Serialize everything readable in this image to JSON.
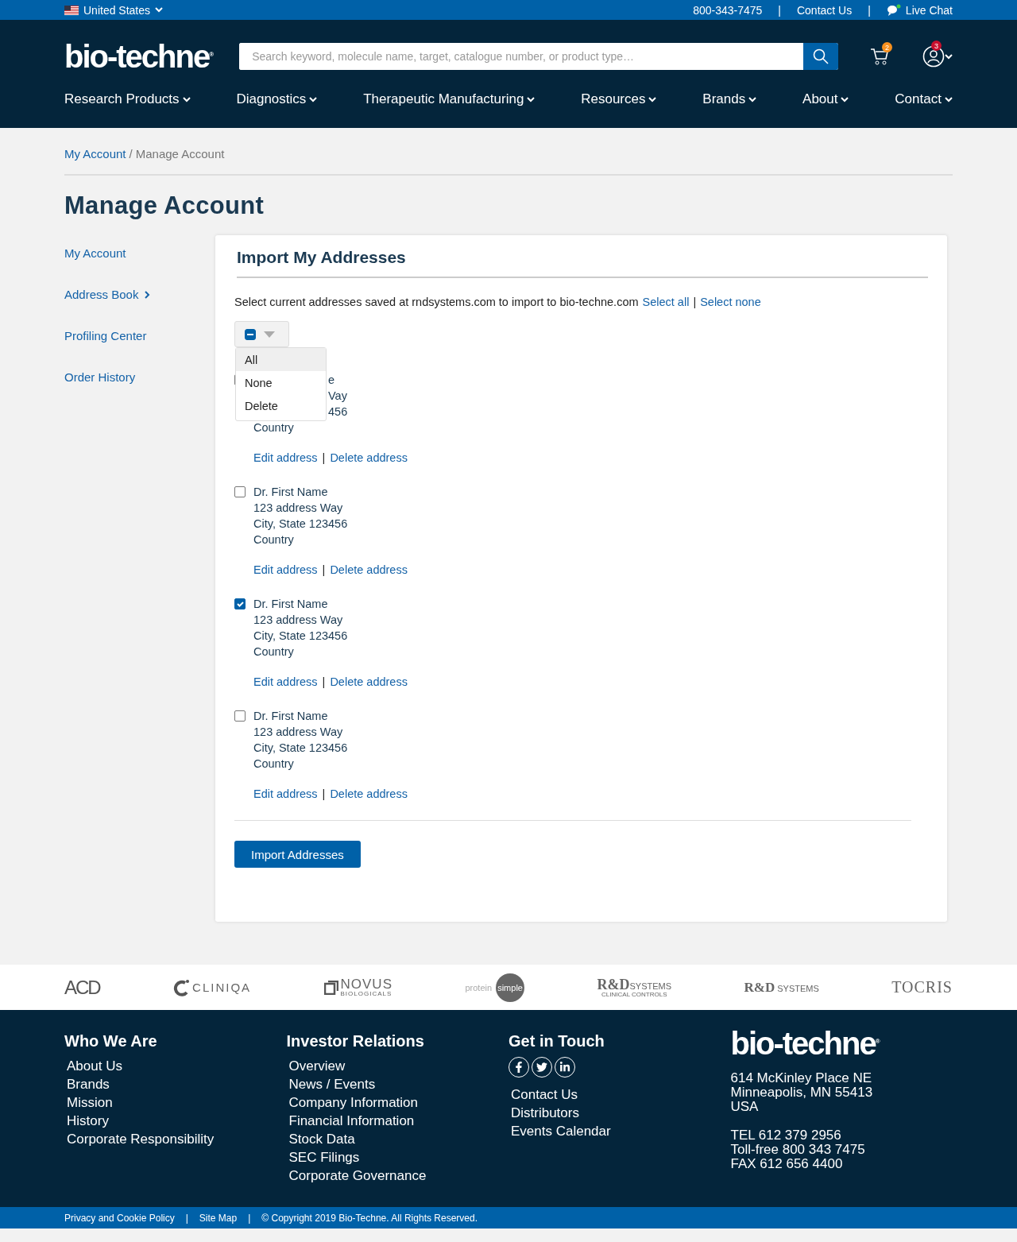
{
  "top_bar": {
    "country": "United States",
    "phone": "800-343-7475",
    "contact": "Contact Us",
    "chat": "Live Chat",
    "separators": [
      "|",
      "|"
    ]
  },
  "header": {
    "logo": "bio-techne",
    "logo_mark": "®",
    "search": {
      "placeholder": "Search keyword, molecule name, target, catalogue number, or product type…"
    },
    "cart_count": "2",
    "account_count": "3"
  },
  "nav": [
    "Research Products",
    "Diagnostics",
    "Therapeutic Manufacturing",
    "Resources",
    "Brands",
    "About",
    "Contact"
  ],
  "breadcrumb": {
    "items": [
      {
        "label": "My Account",
        "link": true
      },
      {
        "label": "Manage Account",
        "link": false
      }
    ],
    "separator": "/"
  },
  "page_title": "Manage Account",
  "sidebar": [
    {
      "label": "My Account",
      "arrow": false
    },
    {
      "label": "Address Book",
      "arrow": true
    },
    {
      "label": "Profiling Center",
      "arrow": false
    },
    {
      "label": "Order History",
      "arrow": false
    }
  ],
  "panel": {
    "title": "Import My Addresses",
    "intro": "Select current addresses saved at rndsystems.com to import to bio-techne.com",
    "select_all": "Select all",
    "separator": "|",
    "select_none": "Select none",
    "bulk_select": {
      "partial": true,
      "expanded": true,
      "options": [
        {
          "label": "All",
          "selected": true
        },
        {
          "label": "None",
          "selected": false
        },
        {
          "label": "Delete",
          "selected": false
        }
      ]
    },
    "addresses": [
      {
        "checked": false,
        "covered": true,
        "lines": [
          "e",
          "Vay",
          "456",
          "Country"
        ],
        "edit": "Edit address",
        "separator": "|",
        "delete": "Delete address"
      },
      {
        "checked": false,
        "lines": [
          "Dr. First Name",
          "123 address Way",
          "City, State 123456",
          "Country"
        ],
        "edit": "Edit address",
        "separator": "|",
        "delete": "Delete address"
      },
      {
        "checked": true,
        "lines": [
          "Dr. First Name",
          "123 address Way",
          "City, State 123456",
          "Country"
        ],
        "edit": "Edit address",
        "separator": "|",
        "delete": "Delete address"
      },
      {
        "checked": false,
        "lines": [
          "Dr. First Name",
          "123 address Way",
          "City, State 123456",
          "Country"
        ],
        "edit": "Edit address",
        "separator": "|",
        "delete": "Delete address"
      }
    ],
    "button": "Import Addresses"
  },
  "brands": [
    {
      "kind": "acd",
      "parts": [
        "ACD"
      ]
    },
    {
      "kind": "cliniqa",
      "parts": [
        "CLINIQA"
      ]
    },
    {
      "kind": "novus",
      "parts": [
        "NOVUS",
        "BIOLOGICALS"
      ]
    },
    {
      "kind": "protein",
      "parts": [
        "protein",
        "simple"
      ]
    },
    {
      "kind": "rdclinical",
      "parts": [
        "R&D",
        "SYSTEMS",
        "CLINICAL CONTROLS"
      ]
    },
    {
      "kind": "rd",
      "parts": [
        "R&D",
        "SYSTEMS"
      ]
    },
    {
      "kind": "tocris",
      "parts": [
        "TOCRIS"
      ]
    }
  ],
  "footer": {
    "columns": [
      {
        "title": "Who We Are",
        "links": [
          "About Us",
          "Brands",
          "Mission",
          "History",
          "Corporate Responsibility"
        ]
      },
      {
        "title": "Investor Relations",
        "links": [
          "Overview",
          "News / Events",
          "Company Information",
          "Financial Information",
          "Stock Data",
          "SEC Filings",
          "Corporate Governance"
        ]
      },
      {
        "title": "Get in Touch",
        "social": true,
        "links": [
          "Contact Us",
          "Distributors",
          "Events Calendar"
        ]
      }
    ],
    "logo": "bio-techne",
    "logo_mark": "®",
    "address": [
      "614 McKinley Place NE",
      "Minneapolis, MN 55413",
      "USA"
    ],
    "phones": [
      "TEL 612 379 2956",
      "Toll-free 800 343 7475",
      "FAX 612 656 4400"
    ]
  },
  "bottom_bar": {
    "links": [
      "Privacy and Cookie Policy",
      "Site Map"
    ],
    "separators": [
      "|",
      "|"
    ],
    "copyright": "© Copyright 2019 Bio-Techne. All Rights Reserved."
  }
}
